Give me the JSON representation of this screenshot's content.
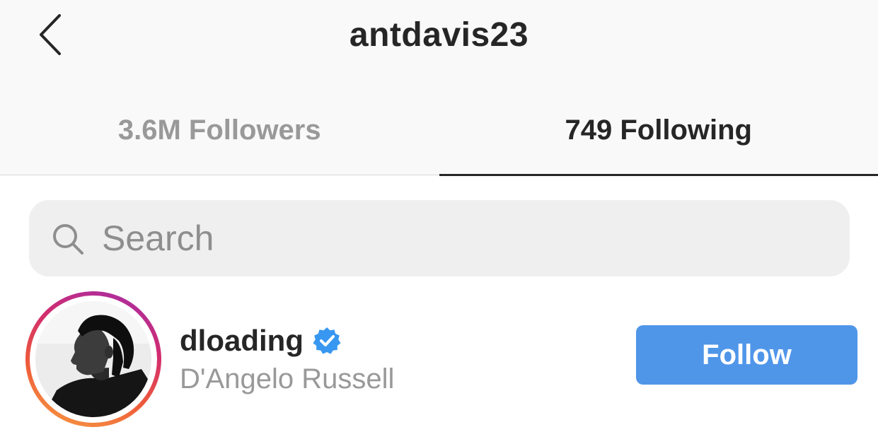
{
  "header": {
    "title": "antdavis23",
    "back_icon": "chevron-left-icon"
  },
  "tabs": [
    {
      "label": "3.6M Followers",
      "active": false
    },
    {
      "label": "749 Following",
      "active": true
    }
  ],
  "search": {
    "placeholder": "Search",
    "value": "",
    "icon": "search-icon"
  },
  "users": [
    {
      "username": "dloading",
      "full_name": "D'Angelo Russell",
      "verified": true,
      "follow_label": "Follow"
    }
  ],
  "colors": {
    "accent": "#4f96e9",
    "verified": "#3897f0",
    "text_primary": "#262626",
    "text_secondary": "#999999",
    "header_bg": "#f9f9f9",
    "search_bg": "#efefef"
  }
}
